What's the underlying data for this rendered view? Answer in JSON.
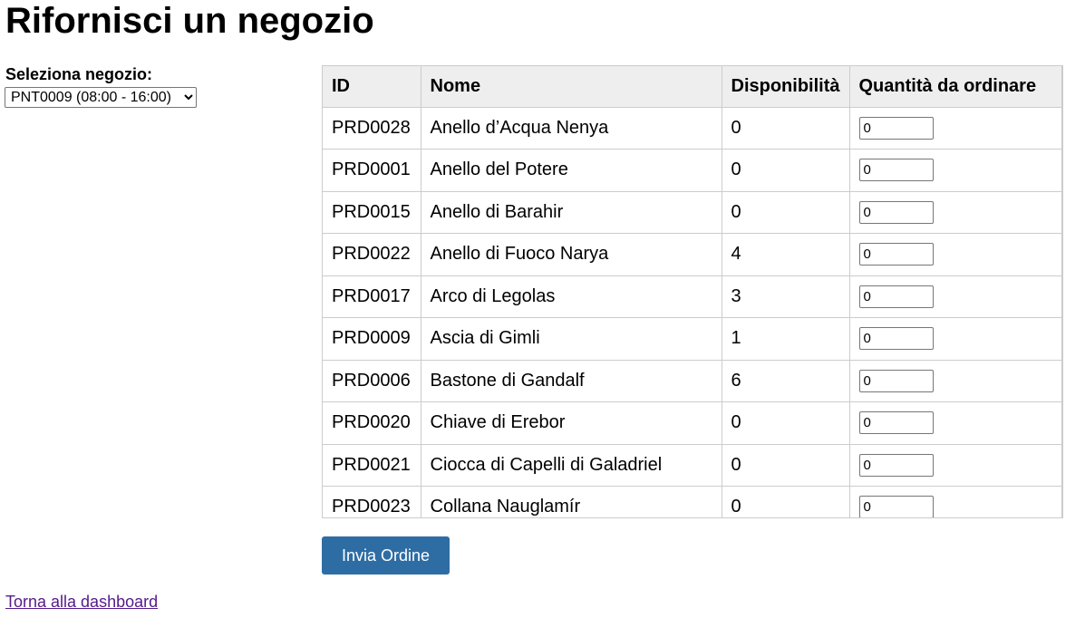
{
  "page": {
    "title": "Rifornisci un negozio"
  },
  "store": {
    "label": "Seleziona negozio:",
    "selected": "PNT0009 (08:00 - 16:00)"
  },
  "table": {
    "headers": [
      "ID",
      "Nome",
      "Disponibilità",
      "Quantità da ordinare"
    ],
    "rows": [
      {
        "id": "PRD0028",
        "name": "Anello d’Acqua Nenya",
        "stock": "0",
        "qty": "0"
      },
      {
        "id": "PRD0001",
        "name": "Anello del Potere",
        "stock": "0",
        "qty": "0"
      },
      {
        "id": "PRD0015",
        "name": "Anello di Barahir",
        "stock": "0",
        "qty": "0"
      },
      {
        "id": "PRD0022",
        "name": "Anello di Fuoco Narya",
        "stock": "4",
        "qty": "0"
      },
      {
        "id": "PRD0017",
        "name": "Arco di Legolas",
        "stock": "3",
        "qty": "0"
      },
      {
        "id": "PRD0009",
        "name": "Ascia di Gimli",
        "stock": "1",
        "qty": "0"
      },
      {
        "id": "PRD0006",
        "name": "Bastone di Gandalf",
        "stock": "6",
        "qty": "0"
      },
      {
        "id": "PRD0020",
        "name": "Chiave di Erebor",
        "stock": "0",
        "qty": "0"
      },
      {
        "id": "PRD0021",
        "name": "Ciocca di Capelli di Galadriel",
        "stock": "0",
        "qty": "0"
      },
      {
        "id": "PRD0023",
        "name": "Collana Nauglamír",
        "stock": "0",
        "qty": "0"
      }
    ]
  },
  "actions": {
    "submit_label": "Invia Ordine",
    "back_link": "Torna alla dashboard"
  },
  "colors": {
    "button": "#2e6da4",
    "header_bg": "#eeeeee",
    "link_visited": "#551a8b"
  }
}
